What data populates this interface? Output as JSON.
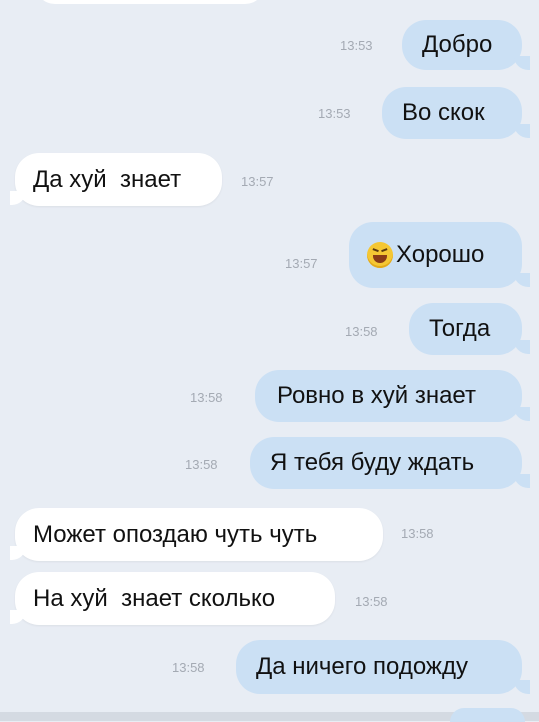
{
  "messages": [
    {
      "dir": "out",
      "text": "Добро",
      "time": "13:53"
    },
    {
      "dir": "out",
      "text": "Во скок",
      "time": "13:53"
    },
    {
      "dir": "in",
      "text": "Да хуй  знает",
      "time": "13:57"
    },
    {
      "dir": "out",
      "text": "Хорошо",
      "time": "13:57",
      "emoji": "grinning-squinting-face-icon"
    },
    {
      "dir": "out",
      "text": "Тогда",
      "time": "13:58"
    },
    {
      "dir": "out",
      "text": "Ровно в хуй знает",
      "time": "13:58"
    },
    {
      "dir": "out",
      "text": "Я тебя буду ждать",
      "time": "13:58"
    },
    {
      "dir": "in",
      "text": "Может опоздаю чуть чуть",
      "time": "13:58"
    },
    {
      "dir": "in",
      "text": "На хуй  знает сколько",
      "time": "13:58"
    },
    {
      "dir": "out",
      "text": "Да ничего подожду",
      "time": "13:58"
    }
  ],
  "colors": {
    "background": "#e8edf4",
    "outgoing_bubble": "#cbe0f4",
    "incoming_bubble": "#ffffff",
    "timestamp": "#a4aab3"
  }
}
